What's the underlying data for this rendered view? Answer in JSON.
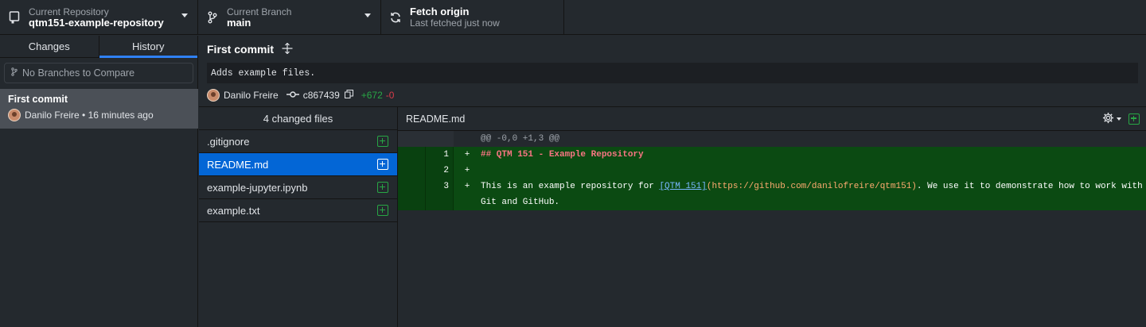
{
  "toolbar": {
    "repo": {
      "label": "Current Repository",
      "value": "qtm151-example-repository"
    },
    "branch": {
      "label": "Current Branch",
      "value": "main"
    },
    "fetch": {
      "label": "Fetch origin",
      "sub": "Last fetched just now"
    }
  },
  "sidebar": {
    "tabs": [
      {
        "label": "Changes"
      },
      {
        "label": "History"
      }
    ],
    "active_tab": "History",
    "compare_placeholder": "No Branches to Compare",
    "commits": [
      {
        "title": "First commit",
        "author": "Danilo Freire",
        "time": "16 minutes ago"
      }
    ]
  },
  "commit": {
    "summary": "First commit",
    "description": "Adds example files.",
    "author": "Danilo Freire",
    "sha": "c867439",
    "additions": "+672",
    "deletions": "-0"
  },
  "files": {
    "header": "4 changed files",
    "items": [
      {
        "name": ".gitignore",
        "status": "added"
      },
      {
        "name": "README.md",
        "status": "added"
      },
      {
        "name": "example-jupyter.ipynb",
        "status": "added"
      },
      {
        "name": "example.txt",
        "status": "added"
      }
    ],
    "selected": "README.md"
  },
  "diff": {
    "file": "README.md",
    "hunk": "@@ -0,0 +1,3 @@",
    "lines": [
      {
        "num": "1",
        "sign": "+",
        "heading": "## QTM 151 - Example Repository"
      },
      {
        "num": "2",
        "sign": "+",
        "text": ""
      },
      {
        "num": "3",
        "sign": "+",
        "pre": "This is an example repository for ",
        "link": "[QTM 151]",
        "url": "(https://github.com/danilofreire/qtm151)",
        "post": ". We use it to demonstrate how to work with",
        "wrap": "Git and GitHub."
      }
    ]
  },
  "colors": {
    "accent": "#2f81f7",
    "selected": "#0366d6",
    "added": "#28a745",
    "removed": "#d73a49",
    "diff_add_bg": "#0b4a12"
  },
  "icons": [
    "repo-icon",
    "branch-icon",
    "sync-icon",
    "chevron-down-icon",
    "git-branch-icon",
    "expand-icon",
    "commit-icon",
    "copy-icon",
    "file-added-icon",
    "gear-icon",
    "add-file-icon"
  ]
}
